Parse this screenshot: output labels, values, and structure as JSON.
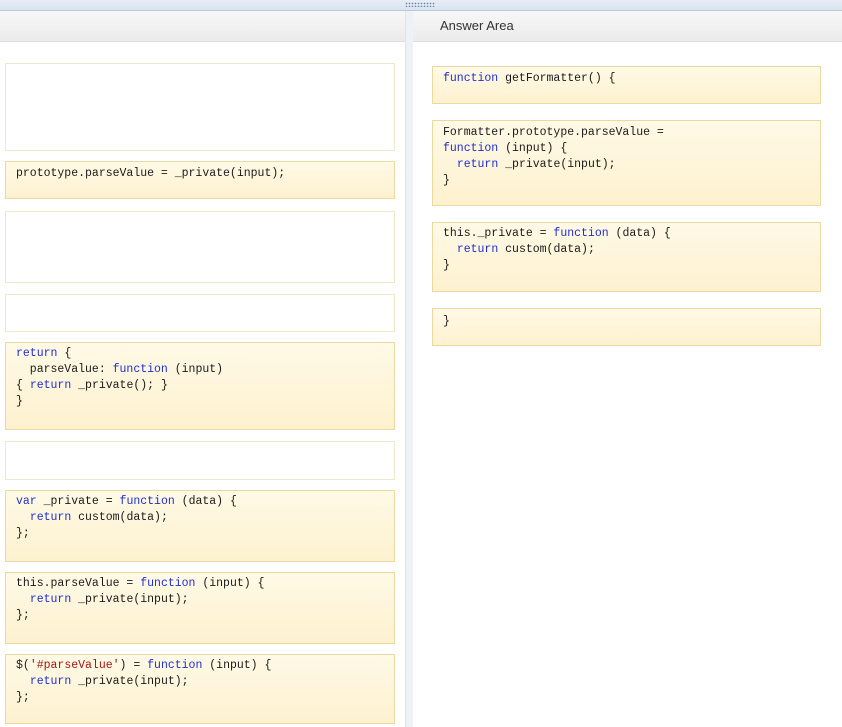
{
  "colors": {
    "keyword": "#1f2fd0",
    "string": "#a51515",
    "tile_bg": "#fdf1cf",
    "tile_border": "#ecd9a0"
  },
  "answer_area": {
    "title": "Answer Area",
    "tiles": [
      {
        "lines": [
          [
            {
              "t": "function",
              "c": "kw"
            },
            {
              "t": " getFormatter() {",
              "c": ""
            }
          ]
        ]
      },
      {
        "lines": [
          [
            {
              "t": "Formatter.prototype.parseValue =",
              "c": ""
            }
          ],
          [
            {
              "t": "function",
              "c": "kw"
            },
            {
              "t": " (input) {",
              "c": ""
            }
          ],
          [
            {
              "t": "  ",
              "c": ""
            },
            {
              "t": "return",
              "c": "kw"
            },
            {
              "t": " _private(input);",
              "c": ""
            }
          ],
          [
            {
              "t": "}",
              "c": ""
            }
          ]
        ]
      },
      {
        "lines": [
          [
            {
              "t": "this._private = ",
              "c": ""
            },
            {
              "t": "function",
              "c": "kw"
            },
            {
              "t": " (data) {",
              "c": ""
            }
          ],
          [
            {
              "t": "  ",
              "c": ""
            },
            {
              "t": "return",
              "c": "kw"
            },
            {
              "t": " custom(data);",
              "c": ""
            }
          ],
          [
            {
              "t": "}",
              "c": ""
            }
          ]
        ]
      },
      {
        "lines": [
          [
            {
              "t": "}",
              "c": ""
            }
          ]
        ]
      }
    ]
  },
  "source_area": {
    "tiles": [
      {
        "lines": [
          [
            {
              "t": "prototype.parseValue = _private(input);",
              "c": ""
            }
          ]
        ]
      },
      {
        "lines": [
          [
            {
              "t": "return",
              "c": "kw"
            },
            {
              "t": " {",
              "c": ""
            }
          ],
          [
            {
              "t": "  parseValue: ",
              "c": ""
            },
            {
              "t": "function",
              "c": "kw"
            },
            {
              "t": " (input)",
              "c": ""
            }
          ],
          [
            {
              "t": "{ ",
              "c": ""
            },
            {
              "t": "return",
              "c": "kw"
            },
            {
              "t": " _private(); }",
              "c": ""
            }
          ],
          [
            {
              "t": "}",
              "c": ""
            }
          ]
        ]
      },
      {
        "lines": [
          [
            {
              "t": "var",
              "c": "kw"
            },
            {
              "t": " _private = ",
              "c": ""
            },
            {
              "t": "function",
              "c": "kw"
            },
            {
              "t": " (data) {",
              "c": ""
            }
          ],
          [
            {
              "t": "  ",
              "c": ""
            },
            {
              "t": "return",
              "c": "kw"
            },
            {
              "t": " custom(data);",
              "c": ""
            }
          ],
          [
            {
              "t": "};",
              "c": ""
            }
          ]
        ]
      },
      {
        "lines": [
          [
            {
              "t": "this.parseValue = ",
              "c": ""
            },
            {
              "t": "function",
              "c": "kw"
            },
            {
              "t": " (input) {",
              "c": ""
            }
          ],
          [
            {
              "t": "  ",
              "c": ""
            },
            {
              "t": "return",
              "c": "kw"
            },
            {
              "t": " _private(input);",
              "c": ""
            }
          ],
          [
            {
              "t": "};",
              "c": ""
            }
          ]
        ]
      },
      {
        "lines": [
          [
            {
              "t": "$(",
              "c": ""
            },
            {
              "t": "'#parseValue'",
              "c": "str"
            },
            {
              "t": ") = ",
              "c": ""
            },
            {
              "t": "function",
              "c": "kw"
            },
            {
              "t": " (input) {",
              "c": ""
            }
          ],
          [
            {
              "t": "  ",
              "c": ""
            },
            {
              "t": "return",
              "c": "kw"
            },
            {
              "t": " _private(input);",
              "c": ""
            }
          ],
          [
            {
              "t": "};",
              "c": ""
            }
          ]
        ]
      }
    ]
  }
}
